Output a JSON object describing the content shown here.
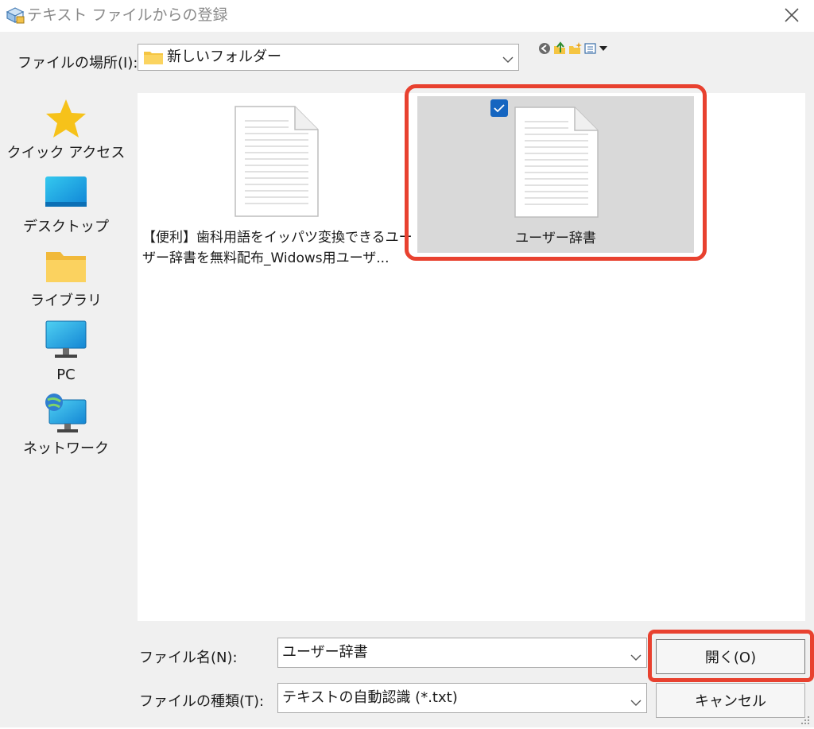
{
  "window": {
    "title": "テキスト ファイルからの登録",
    "close_glyph": "✕"
  },
  "look_in": {
    "label": "ファイルの場所(I):",
    "value": "新しいフォルダー",
    "toolbar_icons": [
      "back-icon",
      "up-folder-icon",
      "new-folder-icon",
      "view-menu-icon"
    ]
  },
  "places": [
    {
      "label": "クイック アクセス",
      "icon": "star-icon"
    },
    {
      "label": "デスクトップ",
      "icon": "desktop-icon"
    },
    {
      "label": "ライブラリ",
      "icon": "folder-icon"
    },
    {
      "label": "PC",
      "icon": "monitor-icon"
    },
    {
      "label": "ネットワーク",
      "icon": "network-icon"
    }
  ],
  "files": [
    {
      "name_line1": "【便利】歯科用語をイッパツ変換できるユー",
      "name_line2": "ザー辞書を無料配布_Widows用ユーザ...",
      "selected": false
    },
    {
      "name": "ユーザー辞書",
      "selected": true
    }
  ],
  "file_name": {
    "label": "ファイル名(N):",
    "value": "ユーザー辞書"
  },
  "file_type": {
    "label": "ファイルの種類(T):",
    "value": "テキストの自動認識 (*.txt)"
  },
  "buttons": {
    "open": "開く(O)",
    "cancel": "キャンセル"
  },
  "colors": {
    "highlight": "#e8412f",
    "selection": "#d9d9d9",
    "checkbox": "#1565c0",
    "dialog_bg": "#f0f0f0"
  }
}
